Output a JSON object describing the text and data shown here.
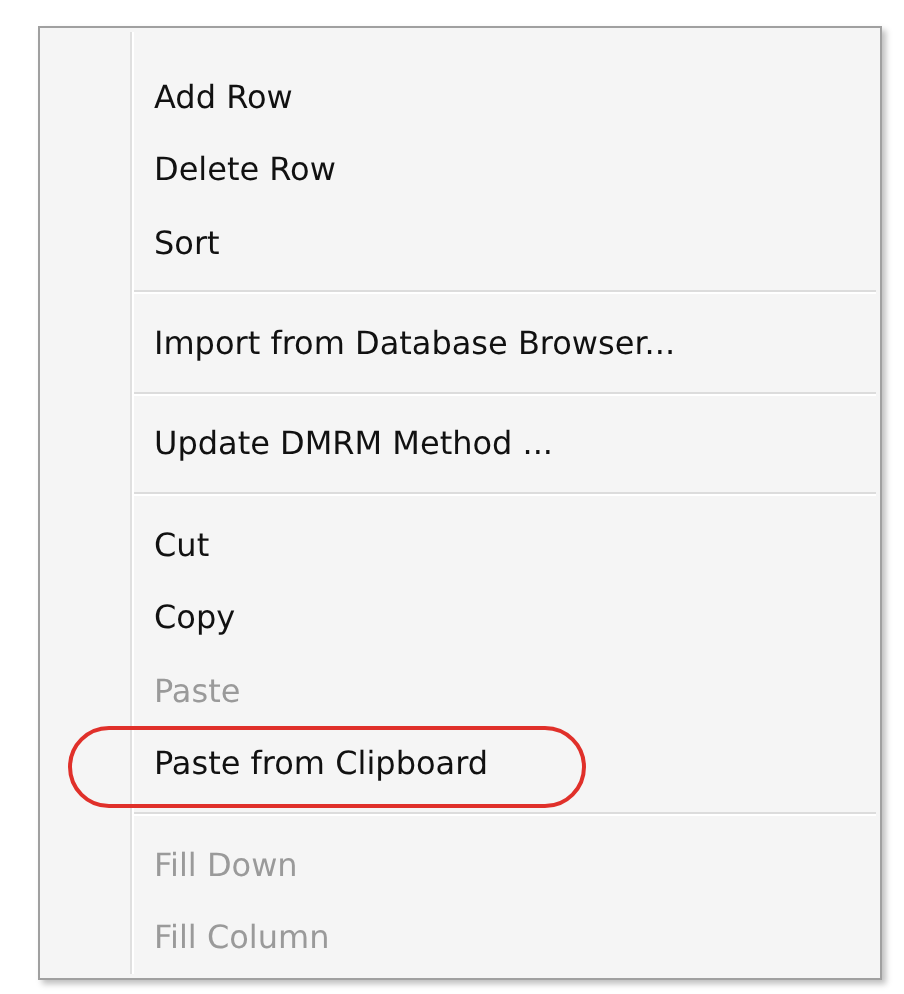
{
  "context_menu": {
    "groups": [
      {
        "items": [
          {
            "label": "Add Row",
            "disabled": false,
            "highlighted": false
          },
          {
            "label": "Delete Row",
            "disabled": false,
            "highlighted": false
          },
          {
            "label": "Sort",
            "disabled": false,
            "highlighted": false
          }
        ]
      },
      {
        "items": [
          {
            "label": "Import from Database Browser...",
            "disabled": false,
            "highlighted": false
          }
        ]
      },
      {
        "items": [
          {
            "label": "Update DMRM Method ...",
            "disabled": false,
            "highlighted": false
          }
        ]
      },
      {
        "items": [
          {
            "label": "Cut",
            "disabled": false,
            "highlighted": false
          },
          {
            "label": "Copy",
            "disabled": false,
            "highlighted": false
          },
          {
            "label": "Paste",
            "disabled": true,
            "highlighted": false
          },
          {
            "label": "Paste from Clipboard",
            "disabled": false,
            "highlighted": true
          }
        ]
      },
      {
        "items": [
          {
            "label": "Fill Down",
            "disabled": true,
            "highlighted": false
          },
          {
            "label": "Fill Column",
            "disabled": true,
            "highlighted": false
          }
        ]
      }
    ]
  }
}
